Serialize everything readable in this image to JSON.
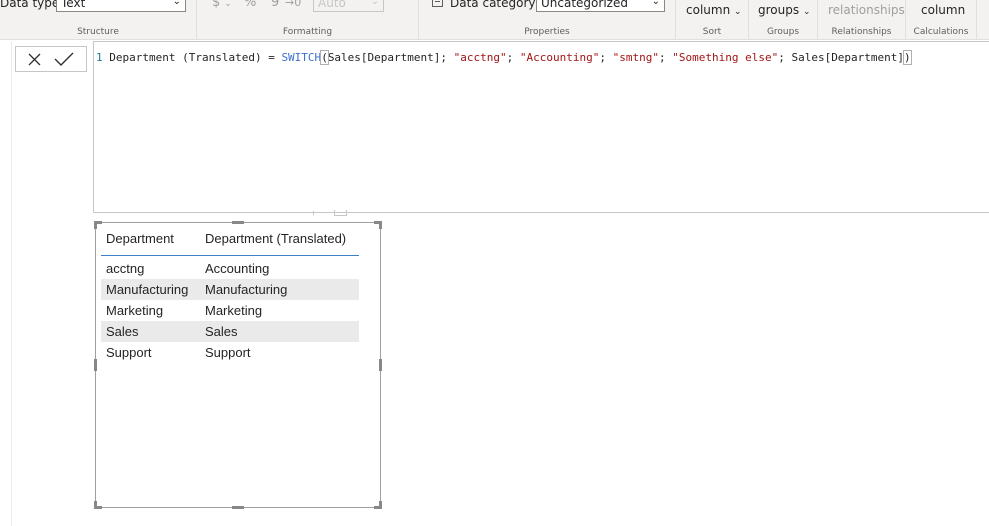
{
  "ribbon": {
    "structure": {
      "label": "Structure",
      "data_type_label": "Data type",
      "data_type_value": "Text"
    },
    "formatting": {
      "label": "Formatting",
      "currency_symbol": "$",
      "percent_symbol": "%",
      "comma_symbol": "9",
      "decimals_symbol": "→0",
      "auto_value": "Auto"
    },
    "properties": {
      "label": "Properties",
      "data_category_label": "Data category",
      "data_category_value": "Uncategorized"
    },
    "sort": {
      "label": "Sort",
      "button_label": "column"
    },
    "groups": {
      "label": "Groups",
      "button_label": "groups"
    },
    "relationships": {
      "label": "Relationships",
      "button_label": "relationships"
    },
    "calculations": {
      "label": "Calculations",
      "button_label": "column"
    }
  },
  "formula_bar": {
    "line_number": "1",
    "code_prefix": " Department (Translated) = ",
    "function_name": "SWITCH",
    "open_paren": "(",
    "arg_column": "Sales[Department]; ",
    "str1": "\"acctng\"",
    "sep1": "; ",
    "str2": "\"Accounting\"",
    "sep2": "; ",
    "str3": "\"smtng\"",
    "sep3": "; ",
    "str4": "\"Something else\"",
    "sep4": "; ",
    "arg_default": "Sales[Department]",
    "close_paren": ")"
  },
  "table_visual": {
    "columns": [
      "Department",
      "Department (Translated)"
    ],
    "rows": [
      [
        "acctng",
        "Accounting"
      ],
      [
        "Manufacturing",
        "Manufacturing"
      ],
      [
        "Marketing",
        "Marketing"
      ],
      [
        "Sales",
        "Sales"
      ],
      [
        "Support",
        "Support"
      ]
    ]
  },
  "icons": {
    "cancel": "close-icon",
    "commit": "checkmark-icon",
    "data_category": "data-category-icon",
    "dropdown": "chevron-down-icon"
  },
  "colors": {
    "keyword": "#3b6fd1",
    "string": "#a31515",
    "header_underline": "#3d7fc9",
    "alt_row": "#eaeaea"
  }
}
